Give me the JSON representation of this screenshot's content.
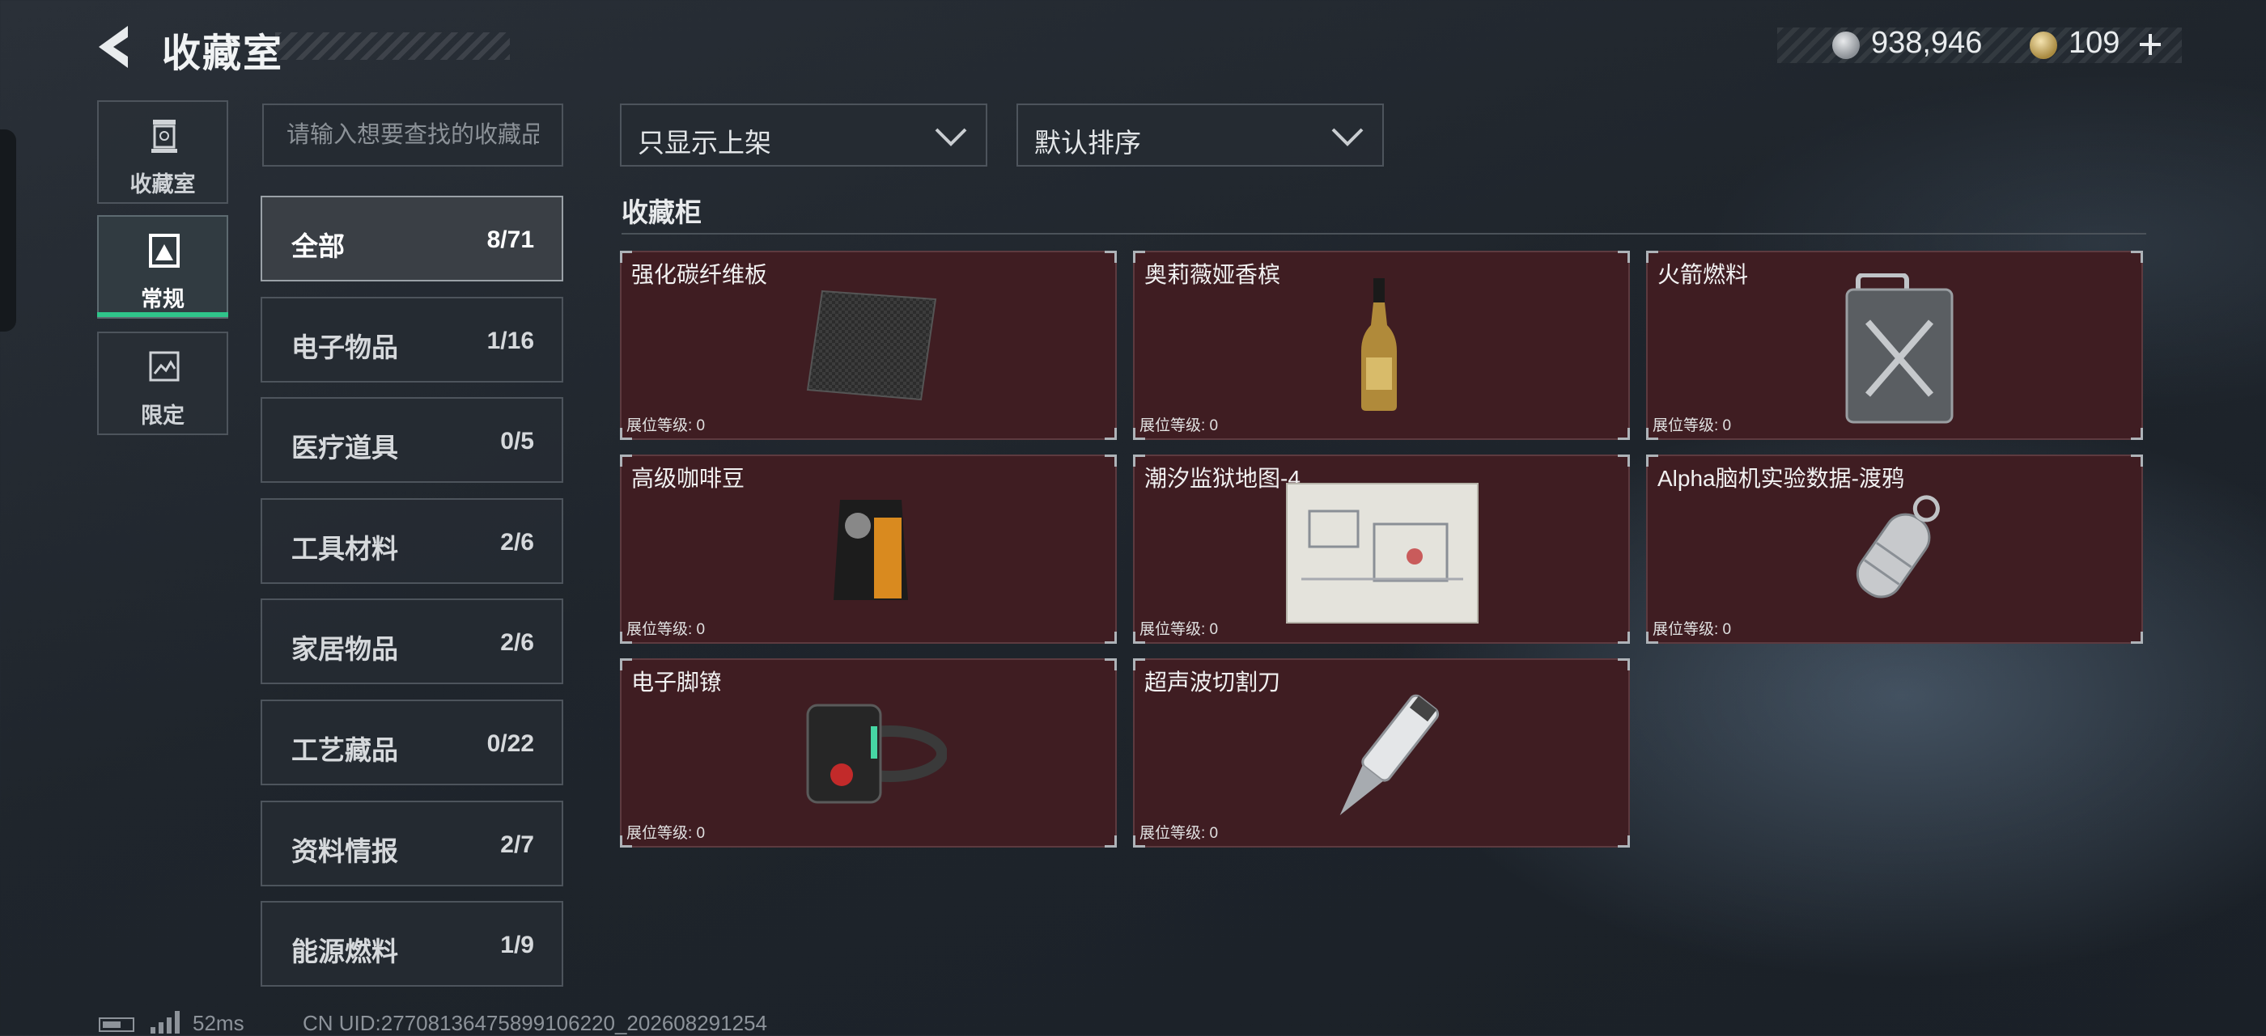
{
  "header": {
    "title": "收藏室"
  },
  "currency": {
    "silver": "938,946",
    "gold": "109"
  },
  "rail": [
    {
      "label": "收藏室",
      "icon": "trophy-icon"
    },
    {
      "label": "常规",
      "icon": "card-icon"
    },
    {
      "label": "限定",
      "icon": "image-icon"
    }
  ],
  "search": {
    "placeholder": "请输入想要查找的收藏品"
  },
  "categories": [
    {
      "label": "全部",
      "count": "8/71"
    },
    {
      "label": "电子物品",
      "count": "1/16"
    },
    {
      "label": "医疗道具",
      "count": "0/5"
    },
    {
      "label": "工具材料",
      "count": "2/6"
    },
    {
      "label": "家居物品",
      "count": "2/6"
    },
    {
      "label": "工艺藏品",
      "count": "0/22"
    },
    {
      "label": "资料情报",
      "count": "2/7"
    },
    {
      "label": "能源燃料",
      "count": "1/9"
    }
  ],
  "filters": {
    "filter_label": "只显示上架",
    "sort_label": "默认排序"
  },
  "section": {
    "title": "收藏柜"
  },
  "items": [
    {
      "name": "强化碳纤维板",
      "grade": "展位等级: 0",
      "icon": "carbon-plate-icon"
    },
    {
      "name": "奥莉薇娅香槟",
      "grade": "展位等级: 0",
      "icon": "champagne-bottle-icon"
    },
    {
      "name": "火箭燃料",
      "grade": "展位等级: 0",
      "icon": "fuel-canister-icon"
    },
    {
      "name": "高级咖啡豆",
      "grade": "展位等级: 0",
      "icon": "coffee-bag-icon"
    },
    {
      "name": "潮汐监狱地图-4",
      "grade": "展位等级: 0",
      "icon": "map-icon"
    },
    {
      "name": "Alpha脑机实验数据-渡鸦",
      "grade": "展位等级: 0",
      "icon": "data-capsule-icon"
    },
    {
      "name": "电子脚镣",
      "grade": "展位等级: 0",
      "icon": "ankle-monitor-icon"
    },
    {
      "name": "超声波切割刀",
      "grade": "展位等级: 0",
      "icon": "ultrasonic-cutter-icon"
    }
  ],
  "footer": {
    "ping": "52ms",
    "uid": "CN UID:27708136475899106220_202608291254"
  },
  "colors": {
    "card_bg": "#3f1d22",
    "accent_green": "#2fc48a",
    "background": "#1f252c"
  }
}
